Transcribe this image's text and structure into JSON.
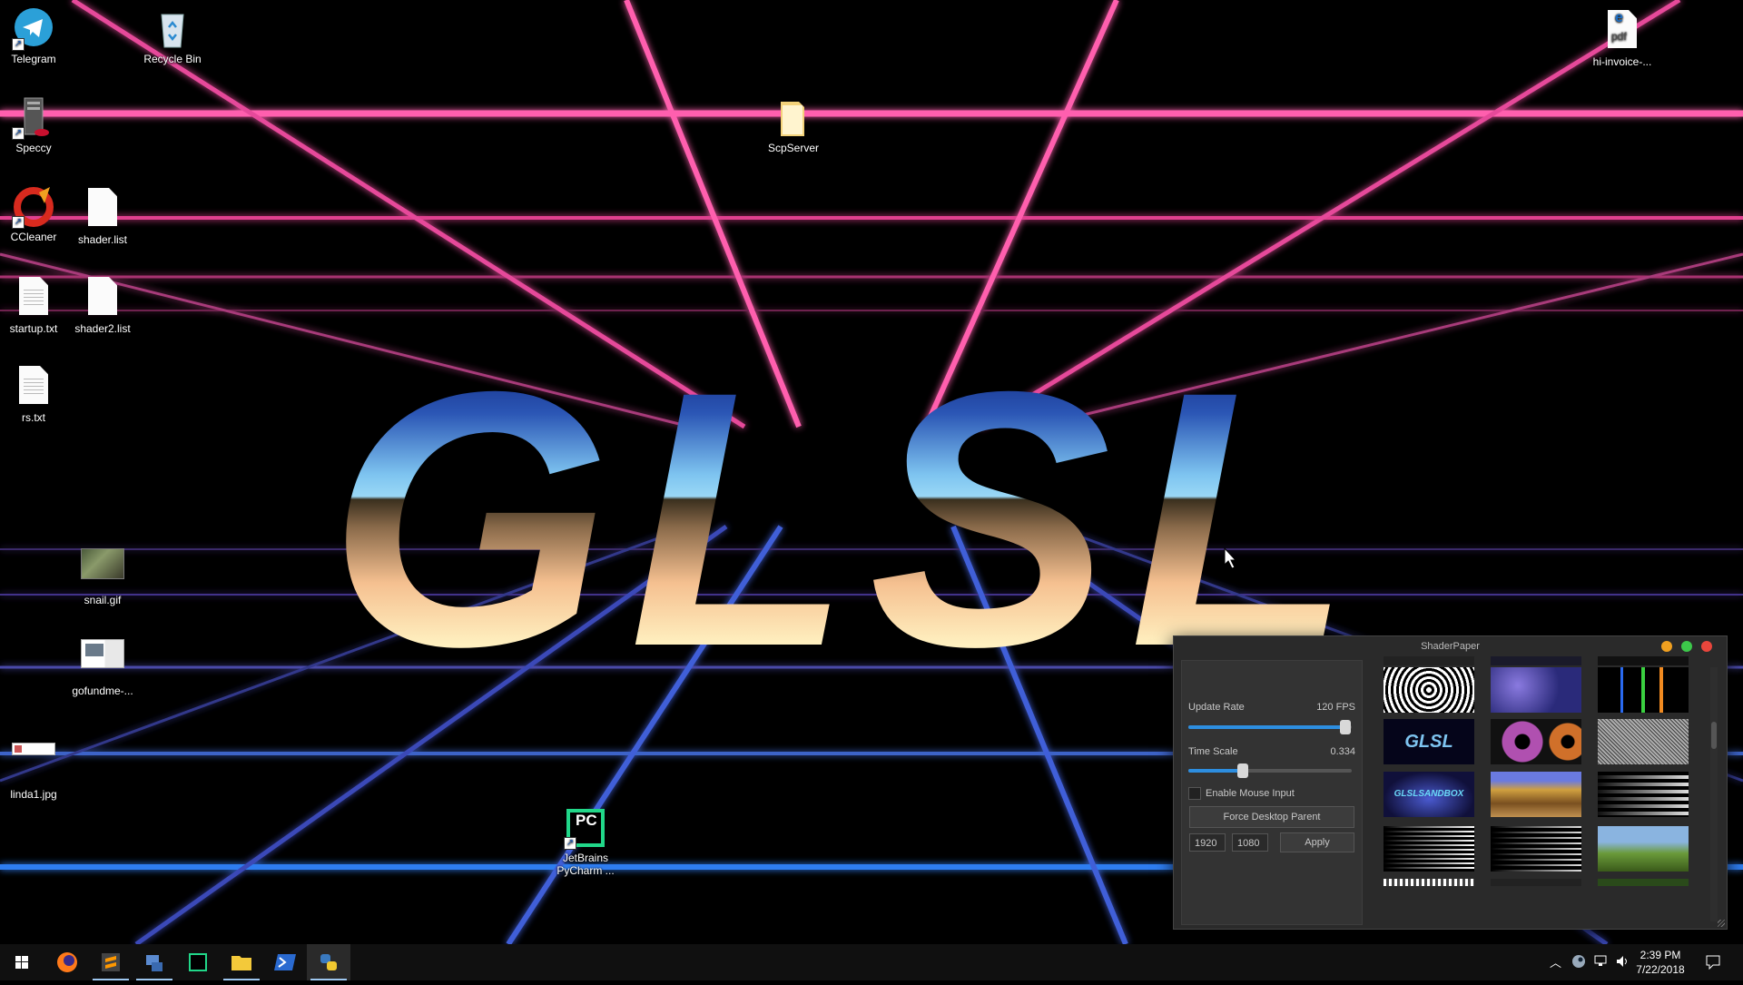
{
  "desktop": {
    "title_text": "GLSL",
    "icons": [
      {
        "label": "Telegram"
      },
      {
        "label": "Recycle Bin"
      },
      {
        "label": "hi-invoice-..."
      },
      {
        "label": "Speccy"
      },
      {
        "label": "ScpServer"
      },
      {
        "label": "CCleaner"
      },
      {
        "label": "shader.list"
      },
      {
        "label": "startup.txt"
      },
      {
        "label": "shader2.list"
      },
      {
        "label": "rs.txt"
      },
      {
        "label": "snail.gif"
      },
      {
        "label": "gofundme-..."
      },
      {
        "label": "linda1.jpg"
      },
      {
        "label": "JetBrains\nPyCharm ..."
      }
    ],
    "pdf_badge": "pdf",
    "pycharm_badge": "PC"
  },
  "shaderpaper": {
    "title": "ShaderPaper",
    "update_rate_label": "Update Rate",
    "update_rate_value": "120 FPS",
    "update_rate_fraction": 0.96,
    "time_scale_label": "Time Scale",
    "time_scale_value": "0.334",
    "time_scale_fraction": 0.334,
    "mouse_input_label": "Enable Mouse Input",
    "mouse_input_checked": false,
    "force_parent_label": "Force Desktop Parent",
    "width_value": "1920",
    "height_value": "1080",
    "apply_label": "Apply",
    "thumb_glsl_text": "GLSL",
    "thumb_sandbox_text": "GLSLSANDBOX"
  },
  "taskbar": {
    "time": "2:39 PM",
    "date": "7/22/2018",
    "pinned": [
      "start-icon",
      "firefox-icon",
      "sublime-text-icon",
      "network-tool-icon",
      "pycharm-icon",
      "file-explorer-icon",
      "powershell-icon",
      "python-app-icon"
    ]
  },
  "colors": {
    "grid_pink": "#ff4fa3",
    "grid_blue": "#2f7df0",
    "accent_blue": "#2d8ee0",
    "close_red": "#e8463c",
    "min_yellow": "#f0a020",
    "max_green": "#3cc84a"
  }
}
